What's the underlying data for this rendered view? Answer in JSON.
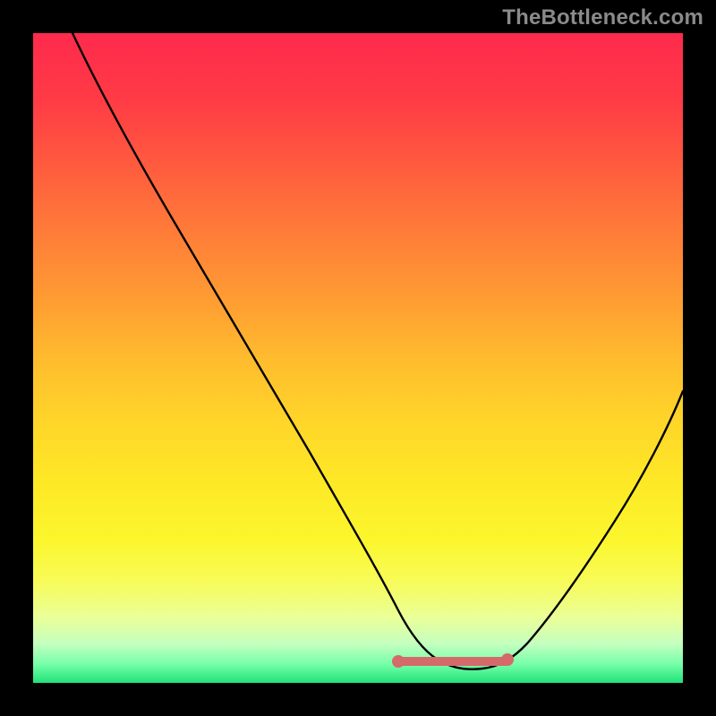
{
  "watermark": {
    "text": "TheBottleneck.com"
  },
  "chart_data": {
    "type": "line",
    "title": "",
    "xlabel": "",
    "ylabel": "",
    "xlim": [
      0,
      100
    ],
    "ylim": [
      0,
      100
    ],
    "curve_main": {
      "name": "bottleneck-curve",
      "x": [
        6,
        10,
        15,
        20,
        25,
        30,
        35,
        40,
        45,
        50,
        55,
        57,
        60,
        63,
        66,
        69,
        72,
        76,
        80,
        85,
        90,
        95,
        100
      ],
      "y": [
        100,
        94,
        86,
        78,
        70,
        62,
        54,
        46,
        38,
        30,
        21,
        15,
        9,
        5,
        3,
        2.5,
        3,
        5,
        10,
        18,
        28,
        39,
        51
      ]
    },
    "plateau_segment": {
      "name": "plateau-highlight",
      "x": [
        56,
        73
      ],
      "y": [
        3.5,
        3.5
      ],
      "color": "#d46a6a",
      "endpoints": true
    },
    "gradient_stops": [
      {
        "pos": 0,
        "color": "#ff2a4d"
      },
      {
        "pos": 50,
        "color": "#ffbb2e"
      },
      {
        "pos": 80,
        "color": "#fbf62d"
      },
      {
        "pos": 100,
        "color": "#20e37a"
      }
    ]
  }
}
